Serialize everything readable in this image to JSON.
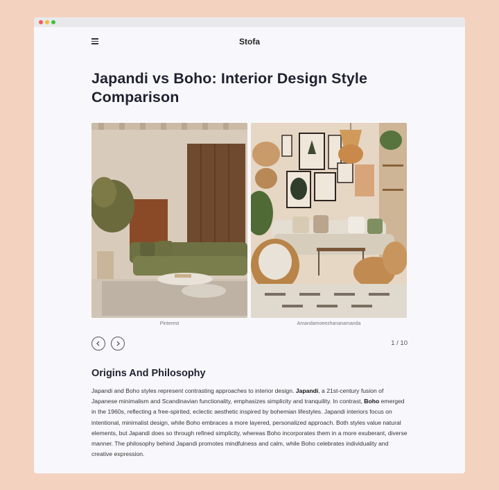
{
  "header": {
    "brand": "Stofa"
  },
  "article": {
    "title": "Japandi vs Boho: Interior Design Style Comparison",
    "gallery": {
      "images": [
        {
          "alt": "Japandi living room",
          "caption": "Pinterest"
        },
        {
          "alt": "Boho living room",
          "caption": "Amandamoeezhananamanda"
        }
      ],
      "pager": "1 / 10"
    },
    "section_heading": "Origins And Philosophy",
    "paragraph": {
      "p1": "Japandi and Boho styles represent contrasting approaches to interior design. ",
      "b1": "Japandi",
      "p2": ", a 21st-century fusion of Japanese minimalism and Scandinavian functionality, emphasizes simplicity and tranquility. In contrast, ",
      "b2": "Boho",
      "p3": " emerged in the 1960s, reflecting a free-spirited, eclectic aesthetic inspired by bohemian lifestyles. Japandi interiors focus on intentional, minimalist design, while Boho embraces a more layered, personalized approach. Both styles value natural elements, but Japandi does so through refined simplicity, whereas Boho incorporates them in a more exuberant, diverse manner. The philosophy behind Japandi promotes mindfulness and calm, while Boho celebrates individuality and creative expression."
    }
  },
  "icons": {
    "menu": "hamburger-icon",
    "prev": "chevron-left-icon",
    "next": "chevron-right-icon"
  },
  "colors": {
    "backdrop": "#f4d2c0",
    "page": "#f8f8fc",
    "text": "#1f2230"
  }
}
